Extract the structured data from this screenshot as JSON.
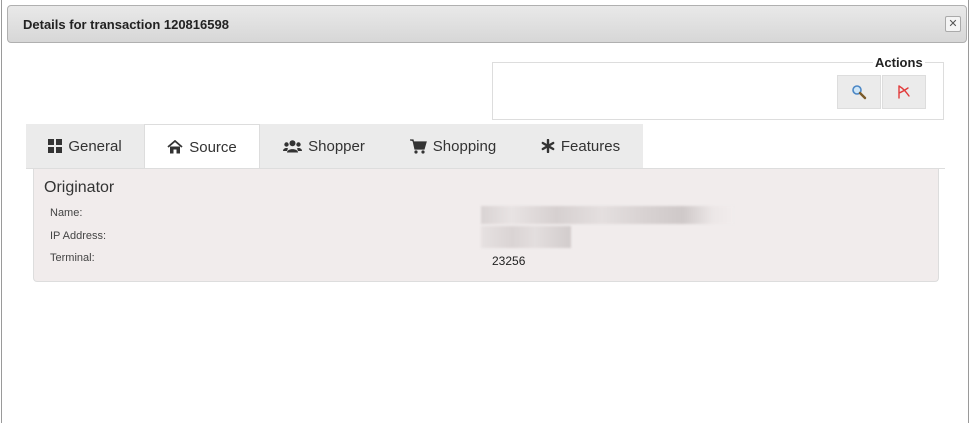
{
  "dialog": {
    "title": "Details for transaction 120816598",
    "close_glyph": "✕"
  },
  "actions": {
    "label": "Actions",
    "buttons": [
      {
        "icon": "magnifier-icon"
      },
      {
        "icon": "pdf-icon"
      }
    ]
  },
  "tabs": [
    {
      "label": "General",
      "icon": "grid-icon"
    },
    {
      "label": "Source",
      "icon": "home-icon",
      "active": true
    },
    {
      "label": "Shopper",
      "icon": "users-icon"
    },
    {
      "label": "Shopping",
      "icon": "cart-icon"
    },
    {
      "label": "Features",
      "icon": "asterisk-icon"
    }
  ],
  "originator": {
    "title": "Originator",
    "fields": [
      {
        "label": "Name:",
        "value": ""
      },
      {
        "label": "IP Address:",
        "value": ""
      },
      {
        "label": "Terminal:",
        "value": "23256"
      }
    ]
  },
  "colors": {
    "panel_bg": "#f1ecec",
    "tab_bg": "#ebebeb",
    "titlebar": "#d7d7d7"
  }
}
